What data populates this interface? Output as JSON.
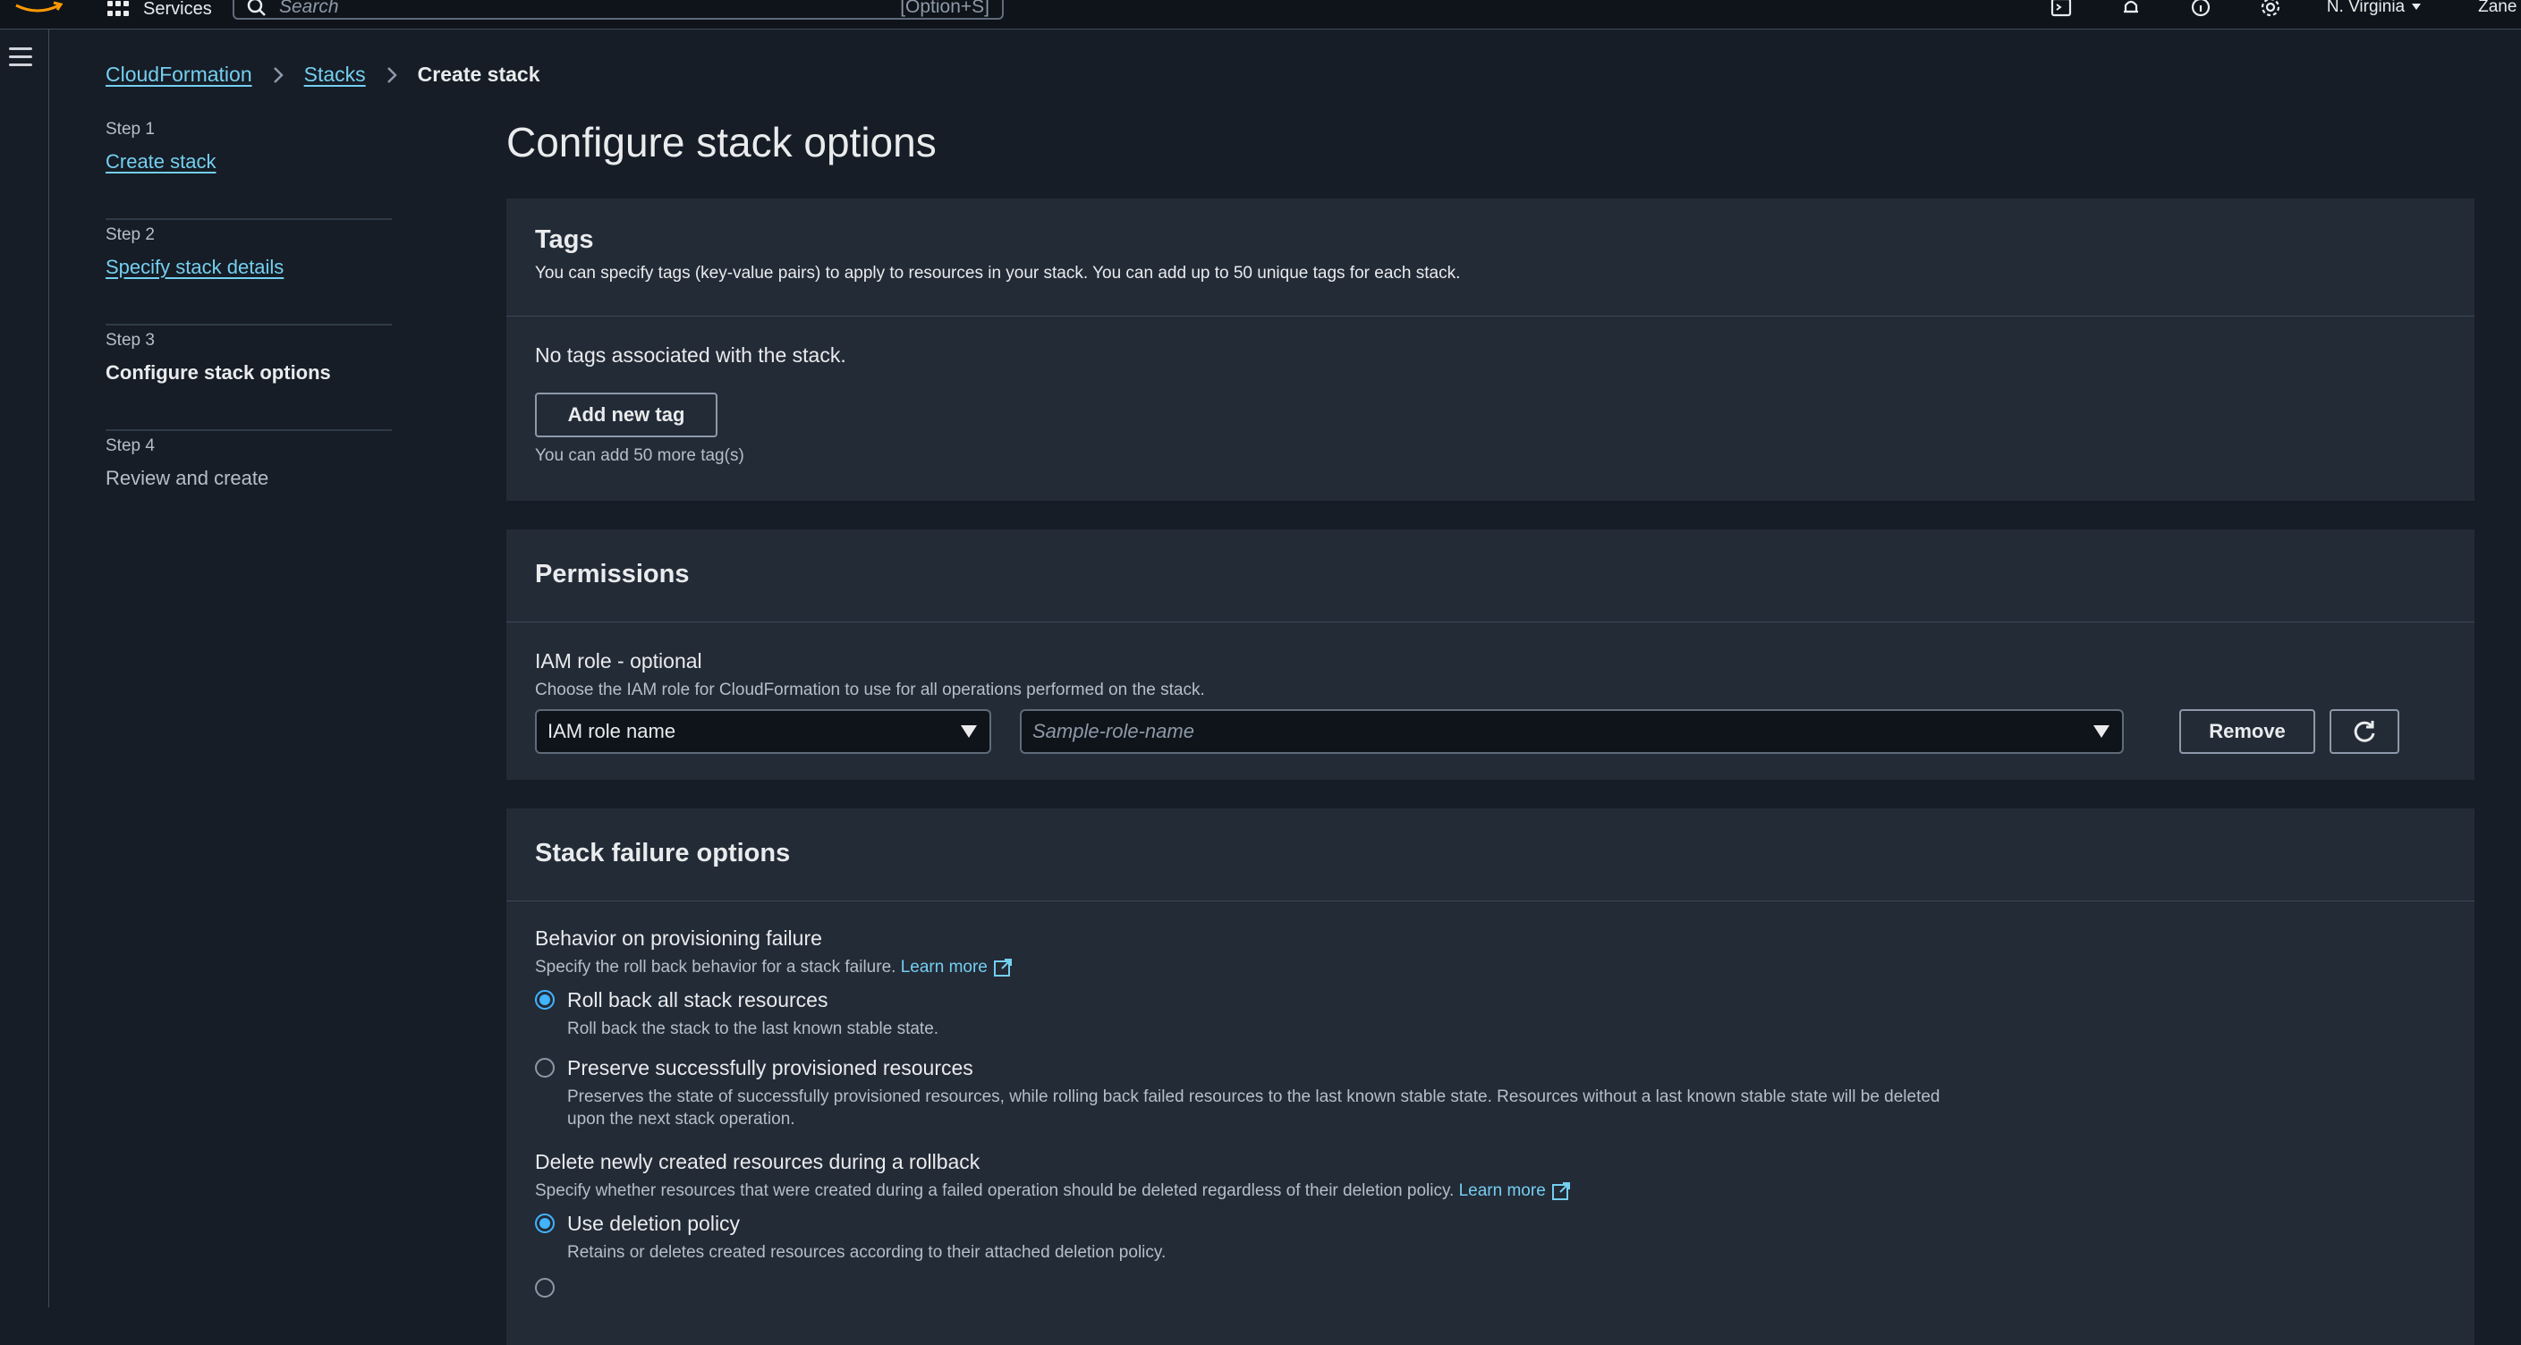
{
  "topnav": {
    "services_label": "Services",
    "search_placeholder": "Search",
    "search_shortcut": "[Option+S]",
    "region": "N. Virginia",
    "user": "Zane @"
  },
  "breadcrumb": {
    "items": [
      "CloudFormation",
      "Stacks"
    ],
    "current": "Create stack"
  },
  "steps": [
    {
      "num": "Step 1",
      "title": "Create stack",
      "state": "link"
    },
    {
      "num": "Step 2",
      "title": "Specify stack details",
      "state": "link"
    },
    {
      "num": "Step 3",
      "title": "Configure stack options",
      "state": "active"
    },
    {
      "num": "Step 4",
      "title": "Review and create",
      "state": "disabled"
    }
  ],
  "page_title": "Configure stack options",
  "tags": {
    "title": "Tags",
    "description": "You can specify tags (key-value pairs) to apply to resources in your stack. You can add up to 50 unique tags for each stack.",
    "empty": "No tags associated with the stack.",
    "add_button": "Add new tag",
    "hint": "You can add 50 more tag(s)"
  },
  "permissions": {
    "title": "Permissions",
    "iam_label": "IAM role - optional",
    "iam_desc": "Choose the IAM role for CloudFormation to use for all operations performed on the stack.",
    "type_select": "IAM role name",
    "role_placeholder": "Sample-role-name",
    "remove_button": "Remove"
  },
  "failure": {
    "title": "Stack failure options",
    "behavior_label": "Behavior on provisioning failure",
    "behavior_desc": "Specify the roll back behavior for a stack failure.",
    "learn_more": "Learn more",
    "options": [
      {
        "label": "Roll back all stack resources",
        "desc": "Roll back the stack to the last known stable state.",
        "checked": true
      },
      {
        "label": "Preserve successfully provisioned resources",
        "desc": "Preserves the state of successfully provisioned resources, while rolling back failed resources to the last known stable state. Resources without a last known stable state will be deleted upon the next stack operation.",
        "checked": false
      }
    ],
    "delete_label": "Delete newly created resources during a rollback",
    "delete_desc": "Specify whether resources that were created during a failed operation should be deleted regardless of their deletion policy.",
    "delete_options": [
      {
        "label": "Use deletion policy",
        "desc": "Retains or deletes created resources according to their attached deletion policy.",
        "checked": true
      }
    ]
  },
  "colors": {
    "accent_link": "#75cff0",
    "radio_selected": "#42b4ff",
    "panel_bg": "#232b37",
    "page_bg": "#161d26"
  }
}
